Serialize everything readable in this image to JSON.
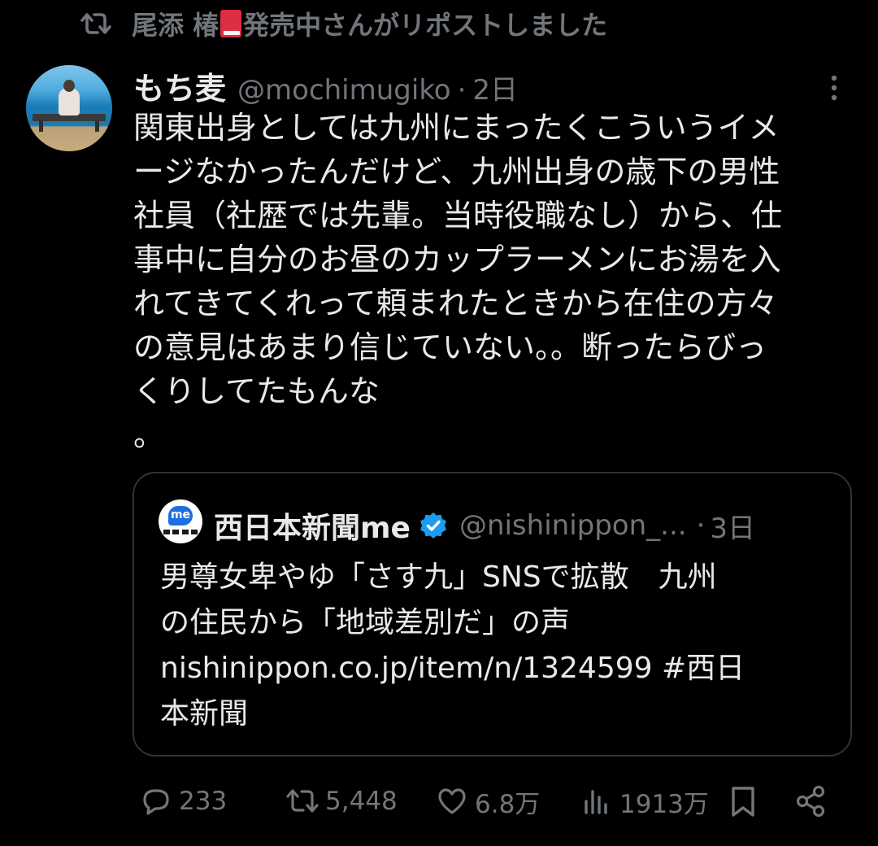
{
  "repost_banner": {
    "prefix": "尾添 椿",
    "suffix": "発売中さんがリポストしました"
  },
  "post": {
    "display_name": "もち麦",
    "handle": "@mochimugiko",
    "separator": "·",
    "time": "2日",
    "text": "関東出身としては九州にまったくこういうイメ\nージなかったんだけど、九州出身の歳下の男性\n社員（社歴では先輩。当時役職なし）から、仕\n事中に自分のお昼のカップラーメンにお湯を入\nれてきてくれって頼まれたときから在住の方々\nの意見はあまり信じていない。。断ったらびっ\nくりしてたもんな\n。"
  },
  "quote": {
    "avatar_text": "me",
    "display_name": "西日本新聞me",
    "handle": "@nishinippon_...",
    "separator": "·",
    "time": "3日",
    "text": "男尊女卑やゆ「さす九」SNSで拡散　九州\nの住民から「地域差別だ」の声\nnishinippon.co.jp/item/n/1324599 #西日\n本新聞"
  },
  "actions": {
    "replies": "233",
    "reposts": "5,448",
    "likes": "6.8万",
    "views": "1913万"
  },
  "icons": {
    "repost": "repost-icon",
    "book": "red-book-emoji",
    "more": "more-vertical-icon",
    "verified": "verified-badge-icon",
    "reply": "reply-icon",
    "like": "heart-icon",
    "views": "views-icon",
    "bookmark": "bookmark-icon",
    "share": "share-icon"
  },
  "colors": {
    "background": "#000000",
    "text": "#e7e9ea",
    "muted": "#71767b",
    "border": "#2f3336",
    "verified": "#1d9bf0",
    "book": "#dd2e44"
  }
}
